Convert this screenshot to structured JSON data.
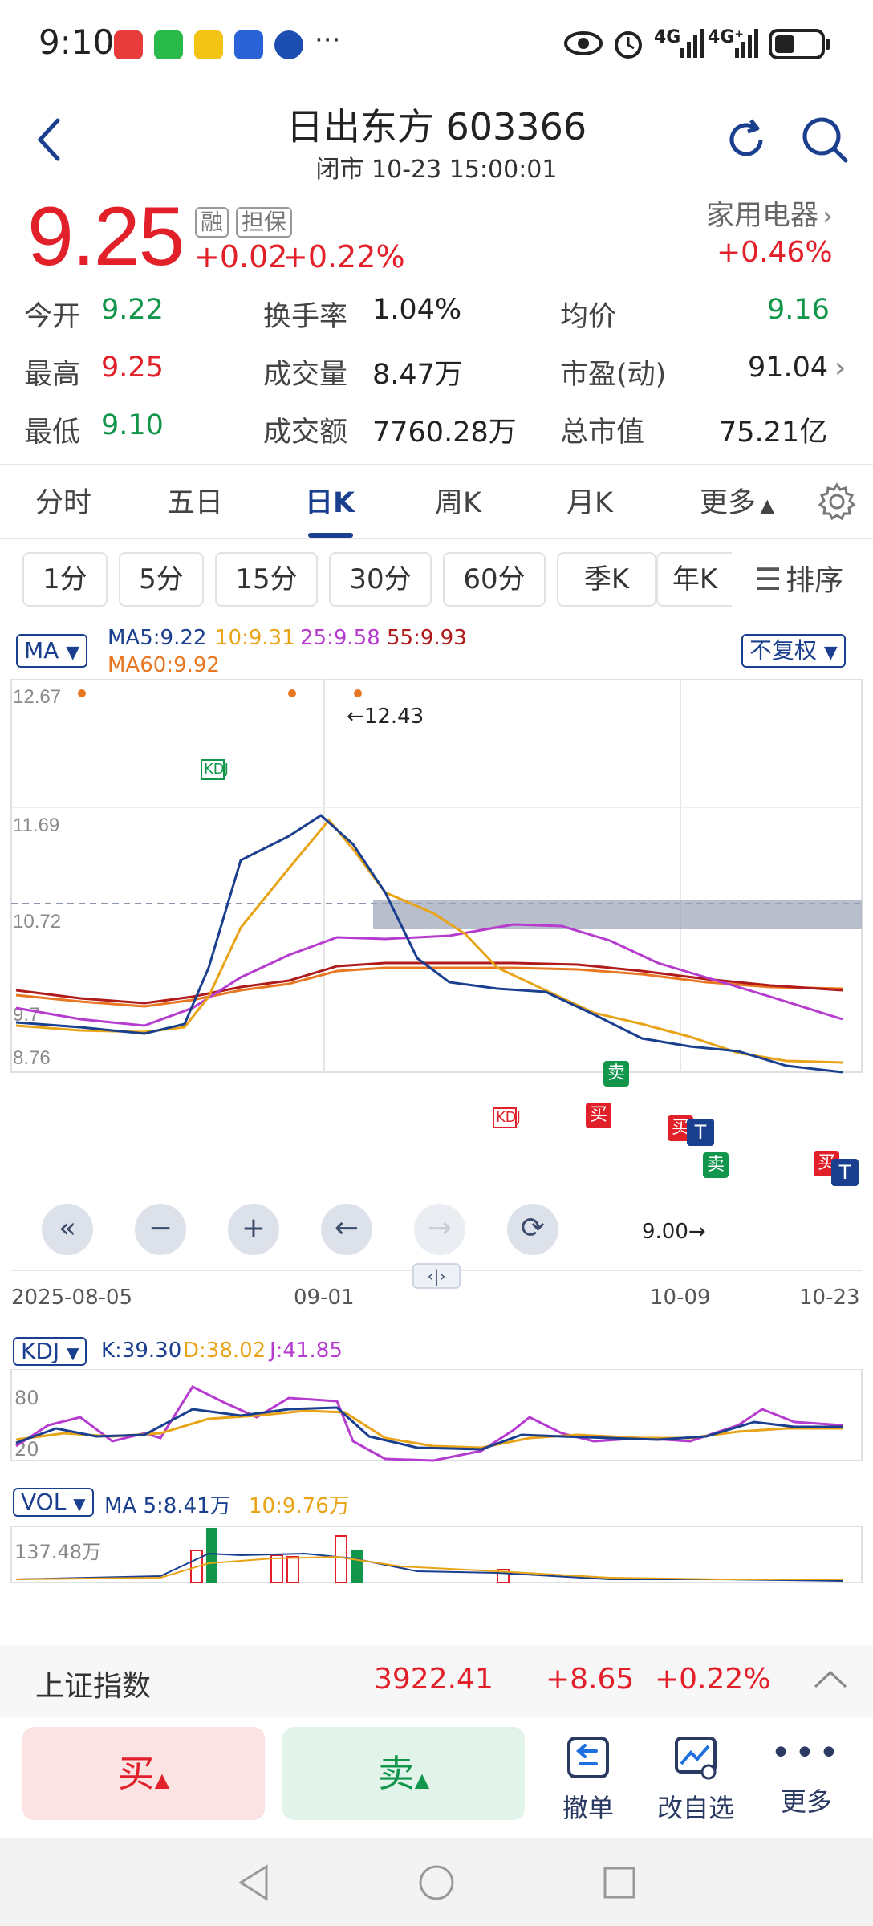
{
  "status": {
    "time": "9:10",
    "dots": "···",
    "net1": "4G",
    "net2": "4G⁺"
  },
  "header": {
    "title": "日出东方 603366",
    "subtitle": "闭市 10-23 15:00:01"
  },
  "quote": {
    "price": "9.25",
    "tag_margin": "融",
    "tag_guarantee": "担保",
    "change": "+0.02",
    "change_pct": "+0.22%",
    "sector": "家用电器",
    "sector_change": "+0.46%",
    "stats": [
      [
        {
          "label": "今开",
          "value": "9.22"
        },
        {
          "label": "换手率",
          "value": "1.04%"
        },
        {
          "label": "均价",
          "value": "9.16"
        }
      ],
      [
        {
          "label": "最高",
          "value": "9.25"
        },
        {
          "label": "成交量",
          "value": "8.47万"
        },
        {
          "label": "市盈(动)",
          "value": "91.04"
        }
      ],
      [
        {
          "label": "最低",
          "value": "9.10"
        },
        {
          "label": "成交额",
          "value": "7760.28万"
        },
        {
          "label": "总市值",
          "value": "75.21亿"
        }
      ]
    ]
  },
  "tabs": [
    "分时",
    "五日",
    "日K",
    "周K",
    "月K",
    "更多"
  ],
  "active_tab": "日K",
  "subtabs": [
    "1分",
    "5分",
    "15分",
    "30分",
    "60分",
    "季K",
    "年K"
  ],
  "sort_label": "排序",
  "chart": {
    "ma_selector": "MA",
    "ma5": "MA5:9.22",
    "ma10": "10:9.31",
    "ma25": "25:9.58",
    "ma55": "55:9.93",
    "ma60": "MA60:9.92",
    "adjust": "不复权",
    "y_top": "12.67",
    "y_mid": "11.69",
    "y_low": "10.72",
    "y_bottom": "8.76",
    "y_partial": "9.7",
    "high_label": "←12.43",
    "low_label": "9.00→",
    "dates": [
      "2025-08-05",
      "09-01",
      "10-09",
      "10-23"
    ],
    "kdj_selector": "KDJ",
    "kdj_k": "K:39.30",
    "kdj_d": "D:38.02",
    "kdj_j": "J:41.85",
    "kdj_80": "80",
    "kdj_20": "20",
    "vol_selector": "VOL",
    "vol_ma5": "MA 5:8.41万",
    "vol_ma10": "10:9.76万",
    "vol_max": "137.48万",
    "sig_buy": "买",
    "sig_sell": "卖",
    "sig_t": "T",
    "kdj_mark": "KDJ",
    "colors": {
      "up": "#e2202a",
      "down": "#12964c",
      "ma5": "#1a3f8f",
      "ma10": "#e8a317",
      "ma25": "#b63ccf",
      "ma55": "#b01a1a",
      "ma60": "#e87722"
    }
  },
  "index_bar": {
    "name": "上证指数",
    "value": "3922.41",
    "change": "+8.65",
    "pct": "+0.22%"
  },
  "bottom": {
    "buy": "买",
    "sell": "卖",
    "cancel": "撤单",
    "edit_watch": "改自选",
    "more": "更多"
  }
}
